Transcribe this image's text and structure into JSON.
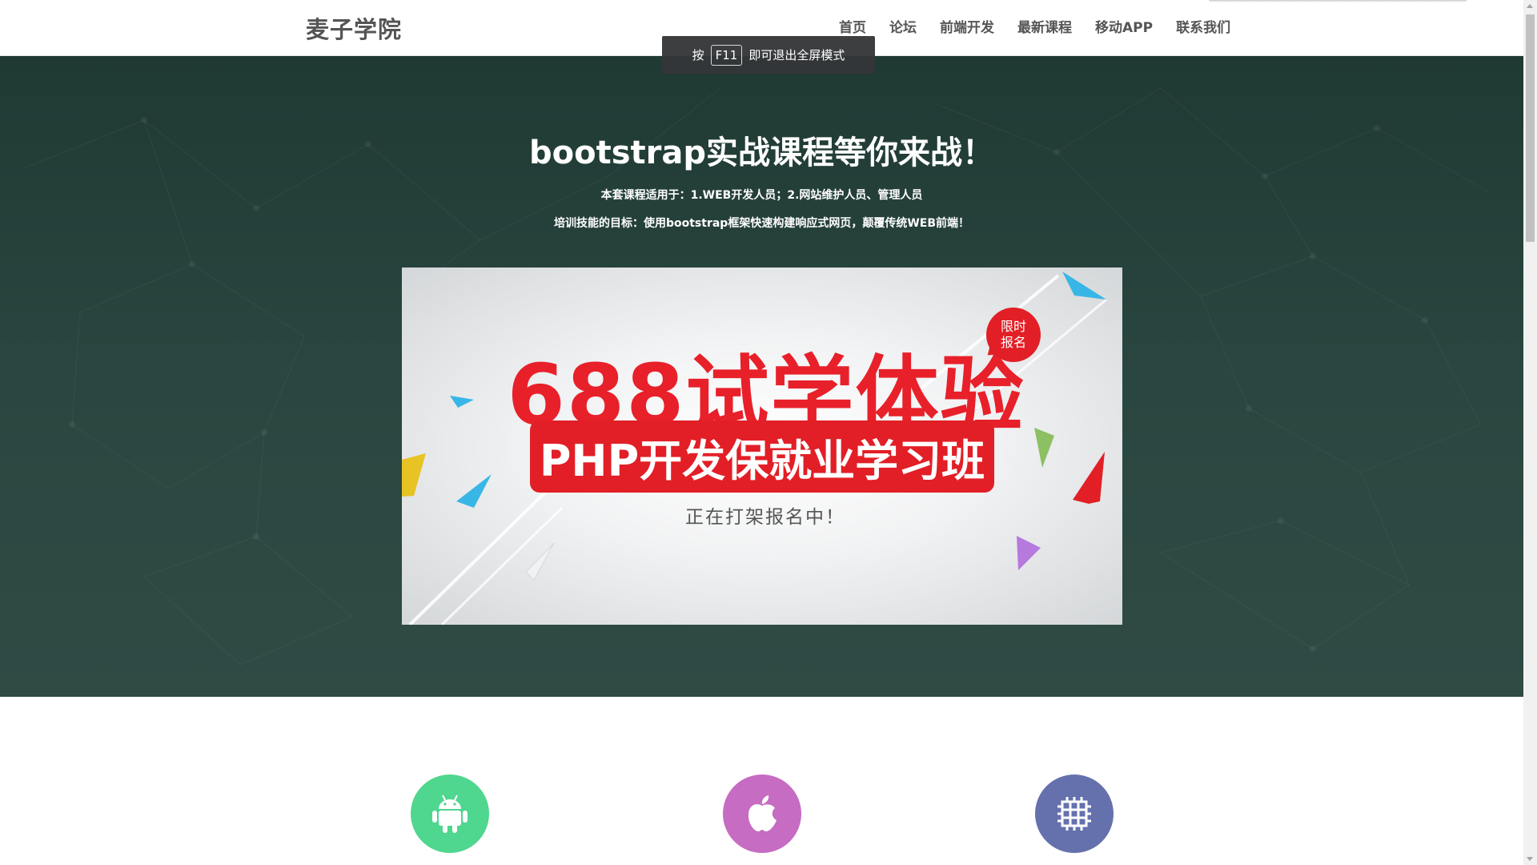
{
  "navbar": {
    "brand": "麦子学院",
    "items": [
      {
        "label": "首页"
      },
      {
        "label": "论坛"
      },
      {
        "label": "前端开发"
      },
      {
        "label": "最新课程"
      },
      {
        "label": "移动APP"
      },
      {
        "label": "联系我们"
      }
    ]
  },
  "toast": {
    "before": "按",
    "key": "F11",
    "after": "即可退出全屏模式"
  },
  "hero": {
    "title": "bootstrap实战课程等你来战！",
    "line1": "本套课程适用于：1.WEB开发人员；2.网站维护人员、管理人员",
    "line2": "培训技能的目标：使用bootstrap框架快速构建响应式网页，颠覆传统WEB前端！"
  },
  "banner": {
    "headline": "688试学体验",
    "pill": "PHP开发保就业学习班",
    "subtitle": "正在打架报名中！",
    "badge_line1": "限时",
    "badge_line2": "报名"
  },
  "features": [
    {
      "icon": "android-icon",
      "color": "#4fd68f"
    },
    {
      "icon": "apple-icon",
      "color": "#c66cc2"
    },
    {
      "icon": "chip-icon",
      "color": "#6571ad"
    }
  ],
  "colors": {
    "hero_bg": "#2a4640",
    "accent_red": "#e21f26",
    "nav_text": "#555555"
  }
}
